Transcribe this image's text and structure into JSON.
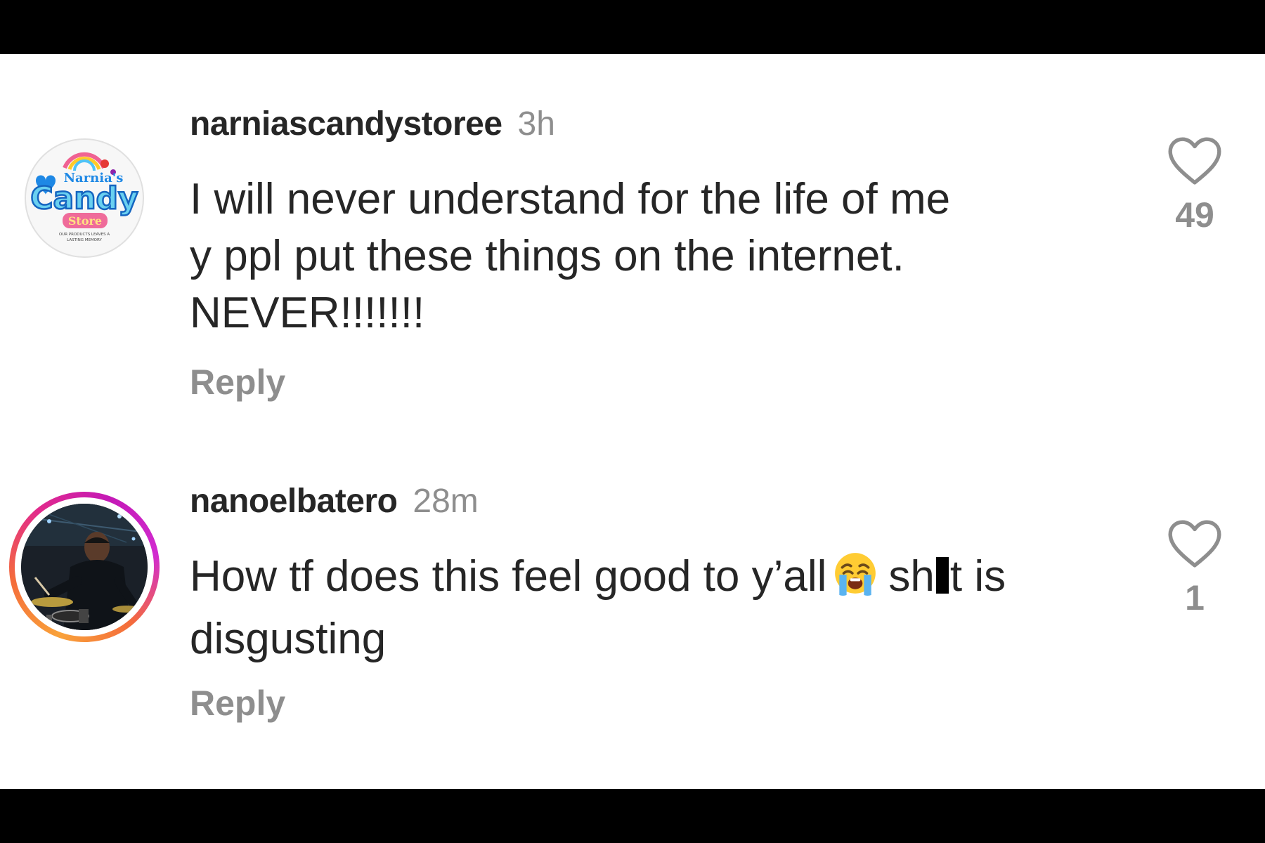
{
  "comments": [
    {
      "username": "narniascandystoree",
      "time": "3h",
      "lines": [
        "I will never understand for the life of me",
        "y ppl put these things on the internet.",
        "NEVER!!!!!!!"
      ],
      "reply_label": "Reply",
      "like_count": "49",
      "avatar": {
        "logo_top": "Narnia's",
        "logo_main": "Candy",
        "logo_sub": "Store",
        "tagline_1": "OUR PRODUCTS LEAVES A",
        "tagline_2": "LASTING MEMORY"
      },
      "heart_icon": "heart-outline-icon"
    },
    {
      "username": "nanoelbatero",
      "time": "28m",
      "line1_before": "How tf does this feel good to y’all",
      "emoji": "loudly-crying-face-emoji",
      "line1_after_a": "sh",
      "line1_after_b": "t is",
      "line2": "disgusting",
      "reply_label": "Reply",
      "like_count": "1",
      "heart_icon": "heart-outline-icon"
    }
  ],
  "colors": {
    "text": "#262626",
    "muted": "#8e8e8e",
    "background": "#ffffff",
    "letterbox": "#000000"
  }
}
